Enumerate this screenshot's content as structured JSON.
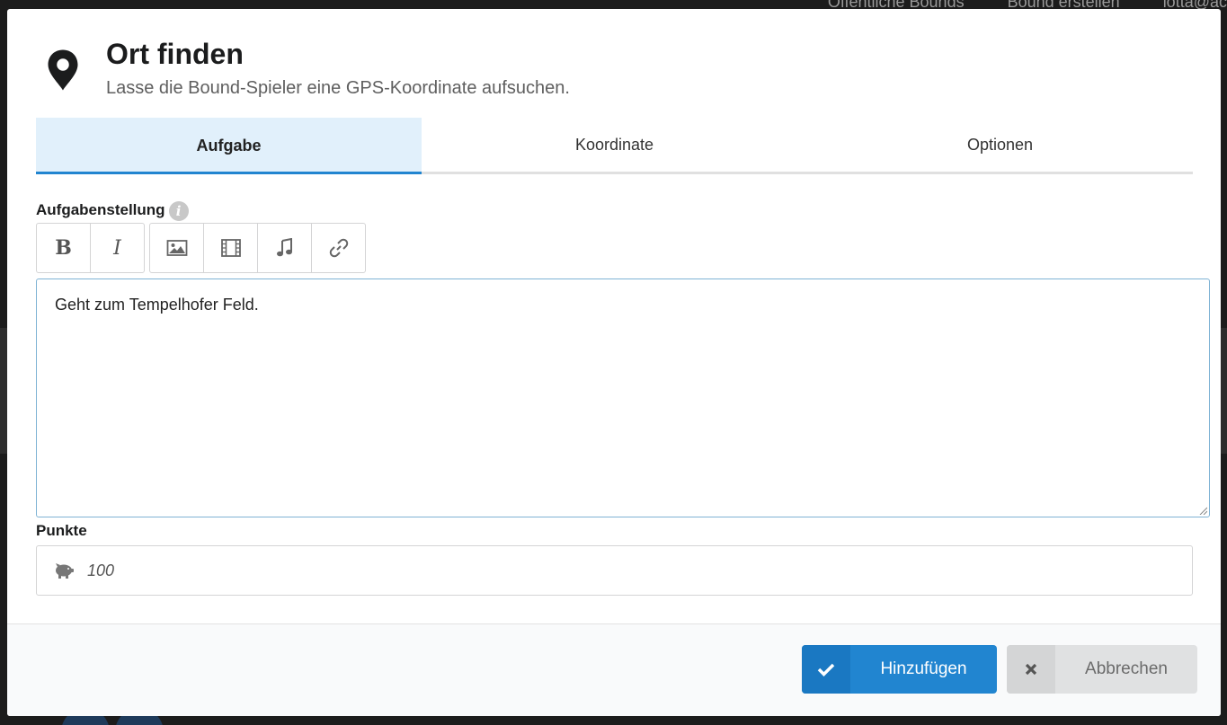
{
  "background_nav": [
    "Öffentliche Bounds",
    "Bound erstellen",
    "lotta@ac"
  ],
  "modal": {
    "title": "Ort finden",
    "subtitle": "Lasse die Bound-Spieler eine GPS-Koordinate aufsuchen.",
    "header_icon": "map-marker-icon",
    "tabs": [
      {
        "label": "Aufgabe",
        "active": true
      },
      {
        "label": "Koordinate",
        "active": false
      },
      {
        "label": "Optionen",
        "active": false
      }
    ],
    "task": {
      "label": "Aufgabenstellung",
      "info_icon": "info-icon",
      "toolbar": {
        "bold_label": "B",
        "italic_label": "I",
        "icons": [
          "image-icon",
          "film-icon",
          "music-icon",
          "link-icon"
        ]
      },
      "text": "Geht zum Tempelhofer Feld."
    },
    "points": {
      "label": "Punkte",
      "icon": "piggy-bank-icon",
      "value": "100"
    },
    "footer": {
      "add_label": "Hinzufügen",
      "add_icon": "checkmark-icon",
      "cancel_label": "Abbrechen",
      "cancel_icon": "close-icon"
    }
  },
  "colors": {
    "primary": "#2185d0",
    "active_tab_bg": "#e1f0fb",
    "cancel_bg": "#e0e1e2"
  }
}
